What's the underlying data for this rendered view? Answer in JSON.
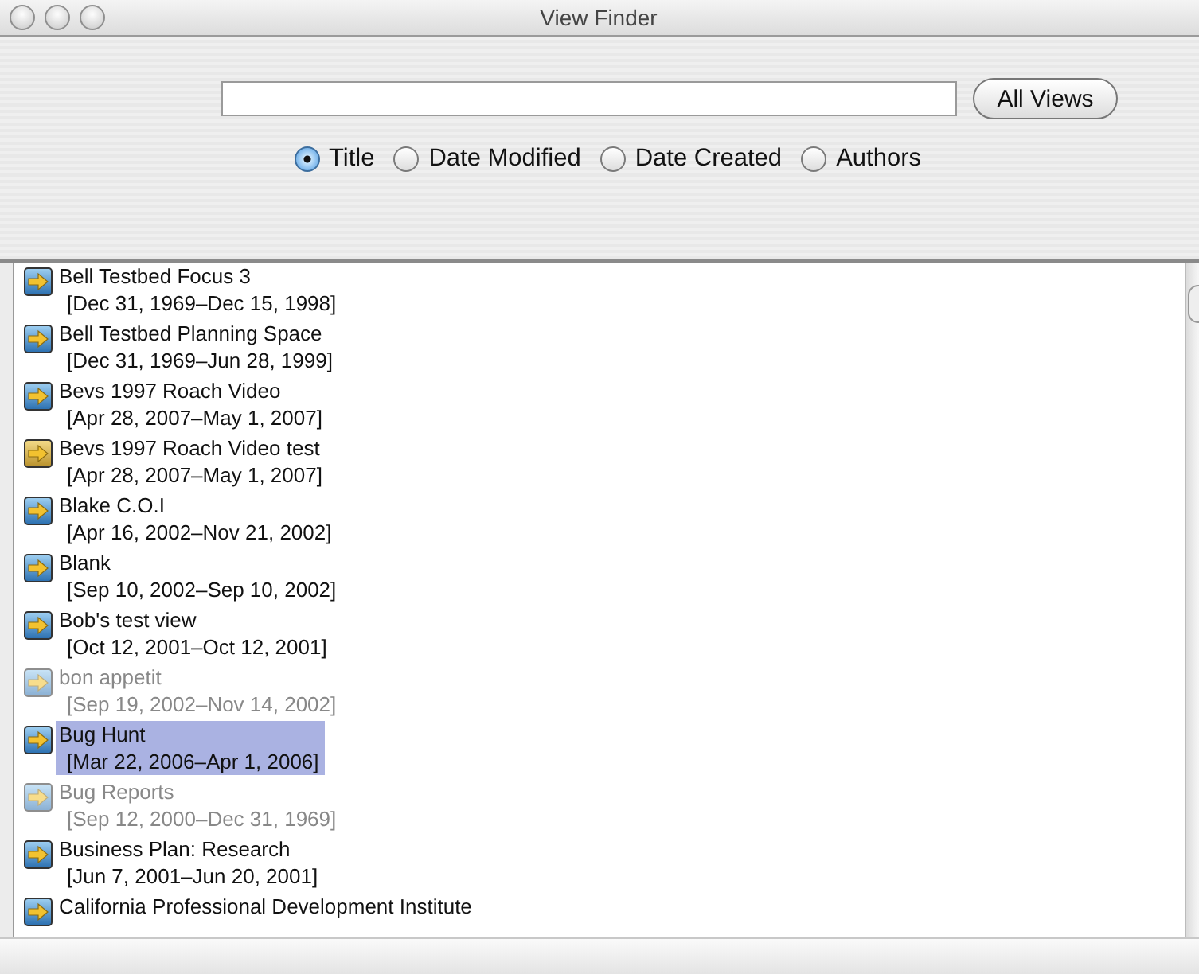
{
  "window": {
    "title": "View Finder"
  },
  "all_views_button": "All Views",
  "sort_options": [
    {
      "label": "Title",
      "selected": true
    },
    {
      "label": "Date Modified",
      "selected": false
    },
    {
      "label": "Date Created",
      "selected": false
    },
    {
      "label": "Authors",
      "selected": false
    }
  ],
  "views": [
    {
      "title": "Bell Testbed Focus 3",
      "dates": "[Dec 31, 1969–Dec 15, 1998]",
      "kind": "blue",
      "disabled": false,
      "selected": false
    },
    {
      "title": "Bell Testbed Planning Space",
      "dates": "[Dec 31, 1969–Jun 28, 1999]",
      "kind": "blue",
      "disabled": false,
      "selected": false
    },
    {
      "title": "Bevs 1997 Roach Video",
      "dates": "[Apr 28, 2007–May 1, 2007]",
      "kind": "blue",
      "disabled": false,
      "selected": false
    },
    {
      "title": "Bevs 1997 Roach Video test",
      "dates": "[Apr 28, 2007–May 1, 2007]",
      "kind": "gold",
      "disabled": false,
      "selected": false
    },
    {
      "title": "Blake C.O.I",
      "dates": "[Apr 16, 2002–Nov 21, 2002]",
      "kind": "blue",
      "disabled": false,
      "selected": false
    },
    {
      "title": "Blank",
      "dates": "[Sep 10, 2002–Sep 10, 2002]",
      "kind": "blue",
      "disabled": false,
      "selected": false
    },
    {
      "title": "Bob's test view",
      "dates": "[Oct 12, 2001–Oct 12, 2001]",
      "kind": "blue",
      "disabled": false,
      "selected": false
    },
    {
      "title": "bon appetit",
      "dates": "[Sep 19, 2002–Nov 14, 2002]",
      "kind": "blue",
      "disabled": true,
      "selected": false
    },
    {
      "title": "Bug Hunt",
      "dates": "[Mar 22, 2006–Apr 1, 2006]",
      "kind": "blue",
      "disabled": false,
      "selected": true
    },
    {
      "title": "Bug Reports",
      "dates": "[Sep 12, 2000–Dec 31, 1969]",
      "kind": "blue",
      "disabled": true,
      "selected": false
    },
    {
      "title": "Business Plan: Research",
      "dates": "[Jun 7, 2001–Jun 20, 2001]",
      "kind": "blue",
      "disabled": false,
      "selected": false
    },
    {
      "title": "California Professional Development Institute",
      "kind": "blue",
      "disabled": false,
      "selected": false
    }
  ]
}
